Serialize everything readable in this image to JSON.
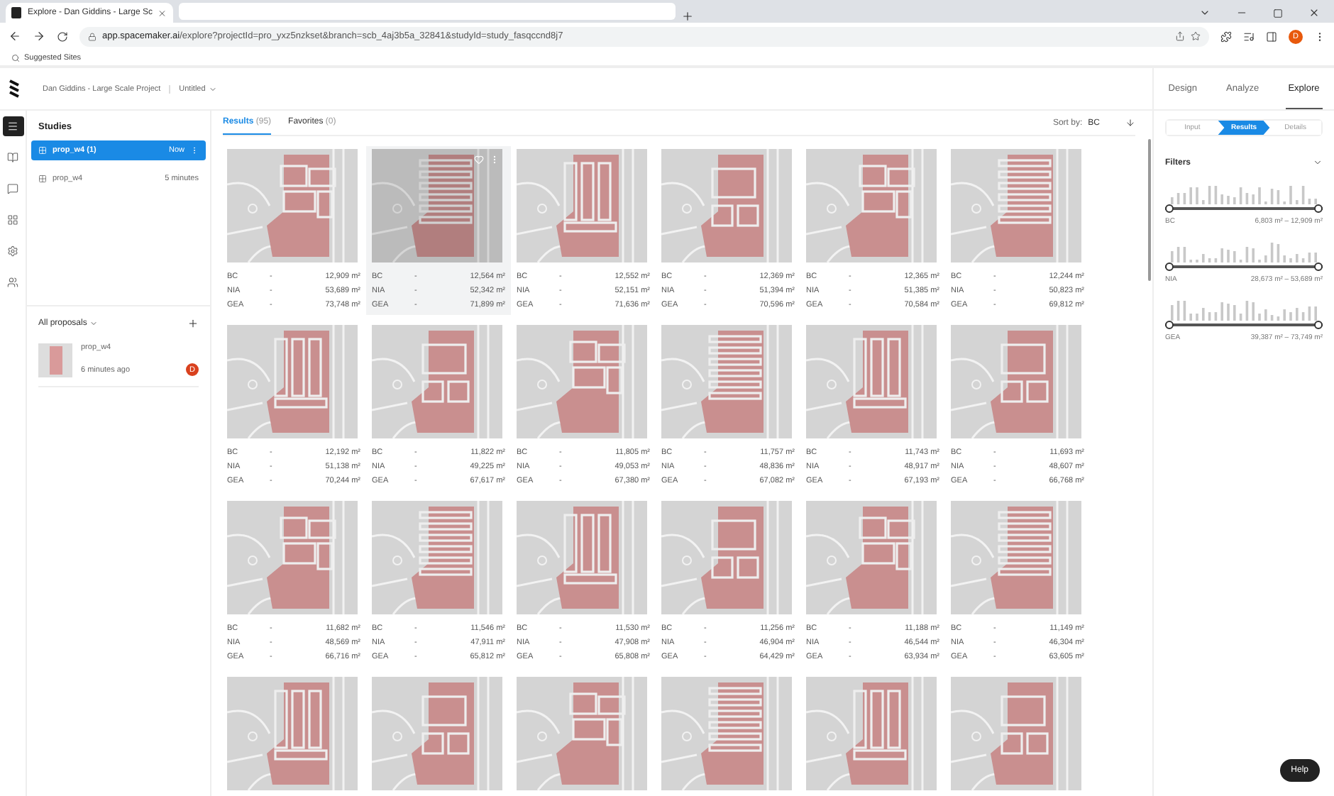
{
  "browser": {
    "tab_title": "Explore - Dan Giddins - Large Sc",
    "url_host": "app.spacemaker.ai",
    "url_path": "/explore?projectId=pro_yxz5nzkset&branch=scb_4aj3b5a_32841&studyId=study_fasqccnd8j7",
    "profile": "D",
    "bookmarks": [
      "Suggested Sites"
    ]
  },
  "header": {
    "project": "Dan Giddins - Large Scale Project",
    "version": "Untitled",
    "tabs": [
      {
        "label": "Design",
        "selected": false
      },
      {
        "label": "Analyze",
        "selected": false
      },
      {
        "label": "Explore",
        "selected": true
      }
    ]
  },
  "rail": [
    {
      "kind": "menu",
      "selected": true
    },
    {
      "kind": "book",
      "selected": false
    },
    {
      "kind": "comment",
      "selected": false
    },
    {
      "kind": "apps",
      "selected": false
    },
    {
      "kind": "settings",
      "selected": false
    },
    {
      "kind": "people",
      "selected": false
    }
  ],
  "studies": {
    "title": "Studies",
    "items": [
      {
        "name": "prop_w4 (1)",
        "time": "Now",
        "selected": true
      },
      {
        "name": "prop_w4",
        "time": "5 minutes",
        "selected": false
      }
    ]
  },
  "proposals": {
    "title": "All proposals",
    "items": [
      {
        "name": "prop_w4",
        "time": "6 minutes ago",
        "avatar": "D"
      }
    ]
  },
  "results_tabs": [
    {
      "label": "Results",
      "count": "(95)",
      "selected": true
    },
    {
      "label": "Favorites",
      "count": "(0)",
      "selected": false
    }
  ],
  "sort": {
    "label": "Sort by:",
    "value": "BC"
  },
  "cards": [
    {
      "highlighted": false,
      "metrics": [
        [
          "BC",
          "-",
          "12,909 m²"
        ],
        [
          "NIA",
          "-",
          "53,689 m²"
        ],
        [
          "GEA",
          "-",
          "73,748 m²"
        ]
      ]
    },
    {
      "highlighted": true,
      "metrics": [
        [
          "BC",
          "-",
          "12,564 m²"
        ],
        [
          "NIA",
          "-",
          "52,342 m²"
        ],
        [
          "GEA",
          "-",
          "71,899 m²"
        ]
      ]
    },
    {
      "highlighted": false,
      "metrics": [
        [
          "BC",
          "-",
          "12,552 m²"
        ],
        [
          "NIA",
          "-",
          "52,151 m²"
        ],
        [
          "GEA",
          "-",
          "71,636 m²"
        ]
      ]
    },
    {
      "highlighted": false,
      "metrics": [
        [
          "BC",
          "-",
          "12,369 m²"
        ],
        [
          "NIA",
          "-",
          "51,394 m²"
        ],
        [
          "GEA",
          "-",
          "70,596 m²"
        ]
      ]
    },
    {
      "highlighted": false,
      "metrics": [
        [
          "BC",
          "-",
          "12,365 m²"
        ],
        [
          "NIA",
          "-",
          "51,385 m²"
        ],
        [
          "GEA",
          "-",
          "70,584 m²"
        ]
      ]
    },
    {
      "highlighted": false,
      "metrics": [
        [
          "BC",
          "-",
          "12,244 m²"
        ],
        [
          "NIA",
          "-",
          "50,823 m²"
        ],
        [
          "GEA",
          "-",
          "69,812 m²"
        ]
      ]
    },
    {
      "highlighted": false,
      "metrics": [
        [
          "BC",
          "-",
          "12,192 m²"
        ],
        [
          "NIA",
          "-",
          "51,138 m²"
        ],
        [
          "GEA",
          "-",
          "70,244 m²"
        ]
      ]
    },
    {
      "highlighted": false,
      "metrics": [
        [
          "BC",
          "-",
          "11,822 m²"
        ],
        [
          "NIA",
          "-",
          "49,225 m²"
        ],
        [
          "GEA",
          "-",
          "67,617 m²"
        ]
      ]
    },
    {
      "highlighted": false,
      "metrics": [
        [
          "BC",
          "-",
          "11,805 m²"
        ],
        [
          "NIA",
          "-",
          "49,053 m²"
        ],
        [
          "GEA",
          "-",
          "67,380 m²"
        ]
      ]
    },
    {
      "highlighted": false,
      "metrics": [
        [
          "BC",
          "-",
          "11,757 m²"
        ],
        [
          "NIA",
          "-",
          "48,836 m²"
        ],
        [
          "GEA",
          "-",
          "67,082 m²"
        ]
      ]
    },
    {
      "highlighted": false,
      "metrics": [
        [
          "BC",
          "-",
          "11,743 m²"
        ],
        [
          "NIA",
          "-",
          "48,917 m²"
        ],
        [
          "GEA",
          "-",
          "67,193 m²"
        ]
      ]
    },
    {
      "highlighted": false,
      "metrics": [
        [
          "BC",
          "-",
          "11,693 m²"
        ],
        [
          "NIA",
          "-",
          "48,607 m²"
        ],
        [
          "GEA",
          "-",
          "66,768 m²"
        ]
      ]
    },
    {
      "highlighted": false,
      "metrics": [
        [
          "BC",
          "-",
          "11,682 m²"
        ],
        [
          "NIA",
          "-",
          "48,569 m²"
        ],
        [
          "GEA",
          "-",
          "66,716 m²"
        ]
      ]
    },
    {
      "highlighted": false,
      "metrics": [
        [
          "BC",
          "-",
          "11,546 m²"
        ],
        [
          "NIA",
          "-",
          "47,911 m²"
        ],
        [
          "GEA",
          "-",
          "65,812 m²"
        ]
      ]
    },
    {
      "highlighted": false,
      "metrics": [
        [
          "BC",
          "-",
          "11,530 m²"
        ],
        [
          "NIA",
          "-",
          "47,908 m²"
        ],
        [
          "GEA",
          "-",
          "65,808 m²"
        ]
      ]
    },
    {
      "highlighted": false,
      "metrics": [
        [
          "BC",
          "-",
          "11,256 m²"
        ],
        [
          "NIA",
          "-",
          "46,904 m²"
        ],
        [
          "GEA",
          "-",
          "64,429 m²"
        ]
      ]
    },
    {
      "highlighted": false,
      "metrics": [
        [
          "BC",
          "-",
          "11,188 m²"
        ],
        [
          "NIA",
          "-",
          "46,544 m²"
        ],
        [
          "GEA",
          "-",
          "63,934 m²"
        ]
      ]
    },
    {
      "highlighted": false,
      "metrics": [
        [
          "BC",
          "-",
          "11,149 m²"
        ],
        [
          "NIA",
          "-",
          "46,304 m²"
        ],
        [
          "GEA",
          "-",
          "63,605 m²"
        ]
      ]
    },
    {
      "highlighted": false
    },
    {
      "highlighted": false
    },
    {
      "highlighted": false
    },
    {
      "highlighted": false
    },
    {
      "highlighted": false
    },
    {
      "highlighted": false
    }
  ],
  "steps": [
    {
      "label": "Input",
      "selected": false
    },
    {
      "label": "Results",
      "selected": true
    },
    {
      "label": "Details",
      "selected": false
    }
  ],
  "filters": {
    "title": "Filters",
    "items": [
      {
        "name": "BC",
        "range": "6,803 m² – 12,909 m²",
        "level": 1
      },
      {
        "name": "NIA",
        "range": "28,673 m² – 53,689 m²",
        "level": 1
      },
      {
        "name": "GEA",
        "range": "39,387 m² – 73,749 m²",
        "level": 1
      }
    ]
  },
  "help": "Help"
}
